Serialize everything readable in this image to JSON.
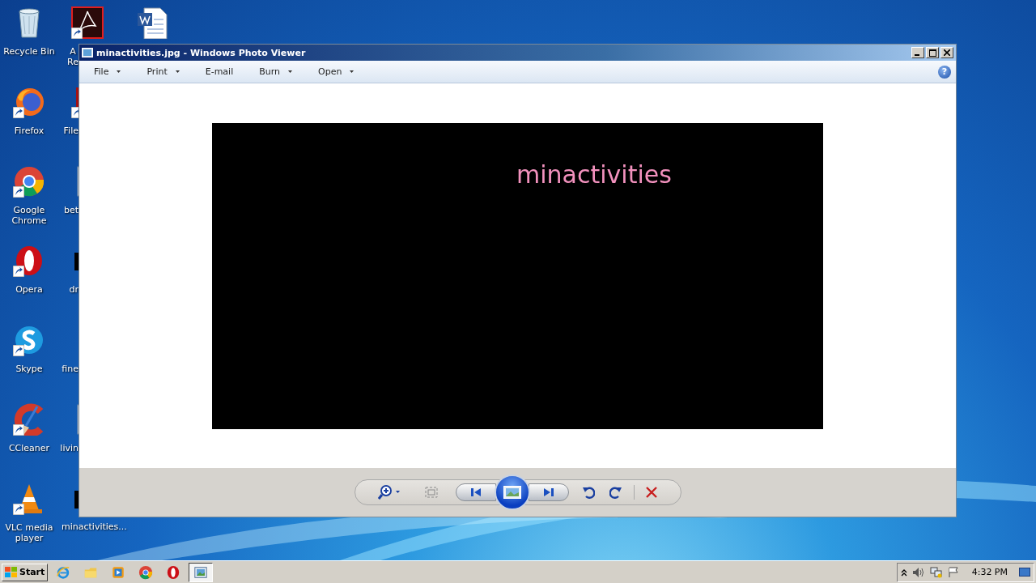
{
  "desktop": {
    "column_1": [
      {
        "kind": "recycle-bin",
        "lines": [
          "Recycle Bin"
        ],
        "shortcut": false
      },
      {
        "kind": "firefox",
        "lines": [
          "Firefox"
        ],
        "shortcut": true
      },
      {
        "kind": "chrome",
        "lines": [
          "Google",
          "Chrome"
        ],
        "shortcut": true
      },
      {
        "kind": "opera",
        "lines": [
          "Opera"
        ],
        "shortcut": true
      },
      {
        "kind": "skype",
        "lines": [
          "Skype"
        ],
        "shortcut": true
      },
      {
        "kind": "ccleaner",
        "lines": [
          "CCleaner"
        ],
        "shortcut": true
      },
      {
        "kind": "vlc",
        "lines": [
          "VLC media",
          "player"
        ],
        "shortcut": true
      }
    ],
    "column_2": [
      {
        "kind": "acrobat",
        "lines": [
          "A",
          "Re"
        ],
        "shortcut": true
      },
      {
        "kind": "red-file",
        "lines": [
          "File"
        ],
        "shortcut": true
      },
      {
        "kind": "document",
        "lines": [
          "bet"
        ],
        "shortcut": false
      },
      {
        "kind": "black-file",
        "lines": [
          "dr"
        ],
        "shortcut": false
      },
      {
        "lines": [
          "fine"
        ],
        "shortcut": false
      },
      {
        "kind": "document",
        "lines": [
          "livin"
        ],
        "shortcut": false
      },
      {
        "kind": "black-file",
        "lines": [
          "minactivities..."
        ],
        "shortcut": false
      }
    ],
    "column_3": [
      {
        "kind": "word",
        "shortcut": false
      }
    ]
  },
  "window": {
    "title": "minactivities.jpg - Windows Photo Viewer",
    "menu": [
      {
        "label": "File",
        "dropdown": true
      },
      {
        "label": "Print",
        "dropdown": true
      },
      {
        "label": "E-mail",
        "dropdown": false
      },
      {
        "label": "Burn",
        "dropdown": true
      },
      {
        "label": "Open",
        "dropdown": true
      }
    ],
    "help_button": "?",
    "image_text": "minactivities"
  },
  "taskbar": {
    "start": "Start",
    "items": [
      {
        "kind": "ie",
        "selected": false
      },
      {
        "kind": "explorer",
        "selected": false
      },
      {
        "kind": "media-player",
        "selected": false
      },
      {
        "kind": "chrome",
        "selected": false
      },
      {
        "kind": "opera",
        "selected": false
      },
      {
        "kind": "photo-viewer",
        "selected": true
      }
    ],
    "clock": "4:32 PM"
  }
}
